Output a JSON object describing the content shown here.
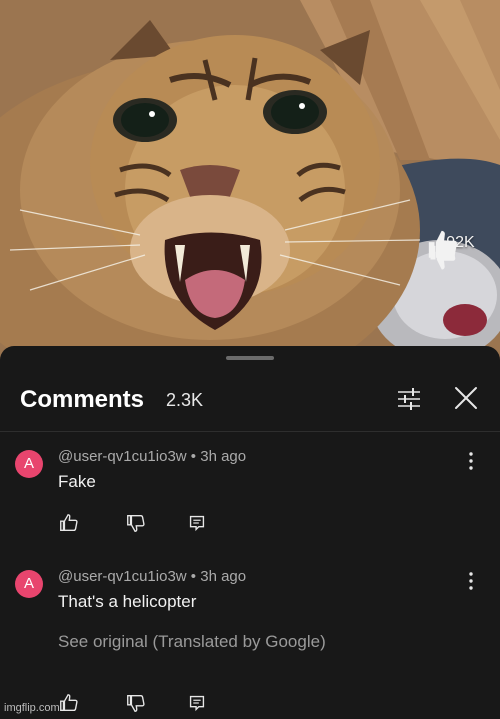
{
  "video": {
    "like_count": "192K"
  },
  "comments_panel": {
    "title": "Comments",
    "count": "2.3K",
    "items": [
      {
        "avatar_letter": "A",
        "avatar_color": "#e8456e",
        "username": "@user-qv1cu1io3w",
        "separator": "•",
        "time": "3h ago",
        "text": "Fake"
      },
      {
        "avatar_letter": "A",
        "avatar_color": "#e8456e",
        "username": "@user-qv1cu1io3w",
        "separator": "•",
        "time": "3h ago",
        "text": "That's a helicopter",
        "see_original": "See original (Translated by Google)"
      }
    ]
  },
  "watermark": "imgflip.com"
}
